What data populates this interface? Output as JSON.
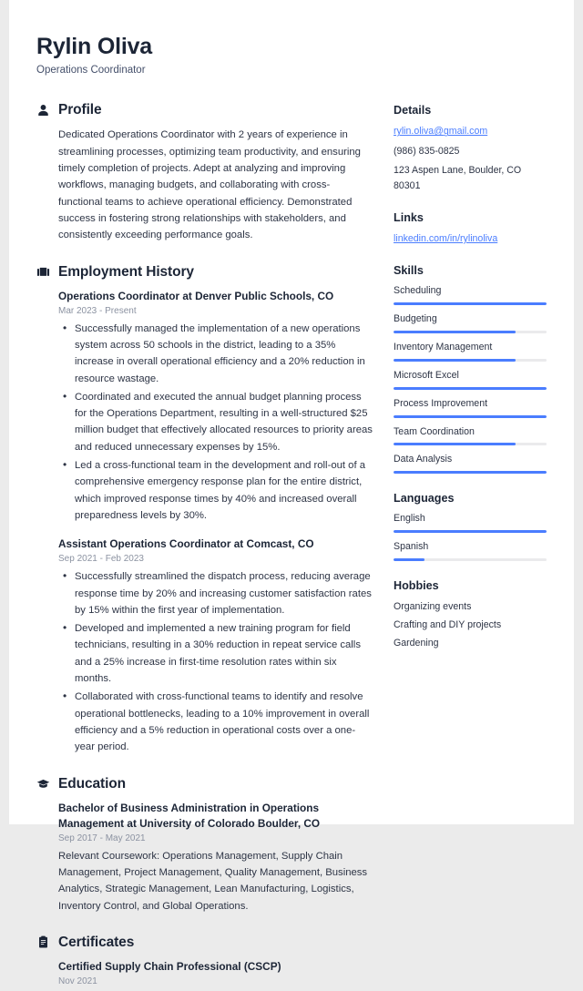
{
  "accent_color": "#4a7dff",
  "text_color": "#2d3445",
  "heading_color": "#1c2536",
  "header": {
    "name": "Rylin Oliva",
    "job_title": "Operations Coordinator"
  },
  "sections": {
    "profile": {
      "icon": "person-icon",
      "title": "Profile",
      "text": "Dedicated Operations Coordinator with 2 years of experience in streamlining processes, optimizing team productivity, and ensuring timely completion of projects. Adept at analyzing and improving workflows, managing budgets, and collaborating with cross-functional teams to achieve operational efficiency. Demonstrated success in fostering strong relationships with stakeholders, and consistently exceeding performance goals."
    },
    "employment": {
      "icon": "briefcase-icon",
      "title": "Employment History",
      "entries": [
        {
          "title": "Operations Coordinator at Denver Public Schools, CO",
          "date": "Mar 2023 - Present",
          "bullets": [
            "Successfully managed the implementation of a new operations system across 50 schools in the district, leading to a 35% increase in overall operational efficiency and a 20% reduction in resource wastage.",
            "Coordinated and executed the annual budget planning process for the Operations Department, resulting in a well-structured $25 million budget that effectively allocated resources to priority areas and reduced unnecessary expenses by 15%.",
            "Led a cross-functional team in the development and roll-out of a comprehensive emergency response plan for the entire district, which improved response times by 40% and increased overall preparedness levels by 30%."
          ]
        },
        {
          "title": "Assistant Operations Coordinator at Comcast, CO",
          "date": "Sep 2021 - Feb 2023",
          "bullets": [
            "Successfully streamlined the dispatch process, reducing average response time by 20% and increasing customer satisfaction rates by 15% within the first year of implementation.",
            "Developed and implemented a new training program for field technicians, resulting in a 30% reduction in repeat service calls and a 25% increase in first-time resolution rates within six months.",
            "Collaborated with cross-functional teams to identify and resolve operational bottlenecks, leading to a 10% improvement in overall efficiency and a 5% reduction in operational costs over a one-year period."
          ]
        }
      ]
    },
    "education": {
      "icon": "graduation-cap-icon",
      "title": "Education",
      "entries": [
        {
          "title": "Bachelor of Business Administration in Operations Management at University of Colorado Boulder, CO",
          "date": "Sep 2017 - May 2021",
          "description": "Relevant Coursework: Operations Management, Supply Chain Management, Project Management, Quality Management, Business Analytics, Strategic Management, Lean Manufacturing, Logistics, Inventory Control, and Global Operations."
        }
      ]
    },
    "certificates": {
      "icon": "clipboard-icon",
      "title": "Certificates",
      "entries": [
        {
          "title": "Certified Supply Chain Professional (CSCP)",
          "date": "Nov 2021"
        }
      ]
    }
  },
  "sidebar": {
    "details": {
      "title": "Details",
      "email": "rylin.oliva@gmail.com",
      "phone": "(986) 835-0825",
      "address": "123 Aspen Lane, Boulder, CO 80301"
    },
    "links": {
      "title": "Links",
      "items": [
        {
          "label": "linkedin.com/in/rylinoliva"
        }
      ]
    },
    "skills": {
      "title": "Skills",
      "items": [
        {
          "name": "Scheduling",
          "level": 100
        },
        {
          "name": "Budgeting",
          "level": 80
        },
        {
          "name": "Inventory Management",
          "level": 80
        },
        {
          "name": "Microsoft Excel",
          "level": 100
        },
        {
          "name": "Process Improvement",
          "level": 100
        },
        {
          "name": "Team Coordination",
          "level": 80
        },
        {
          "name": "Data Analysis",
          "level": 100
        }
      ]
    },
    "languages": {
      "title": "Languages",
      "items": [
        {
          "name": "English",
          "level": 100
        },
        {
          "name": "Spanish",
          "level": 20
        }
      ]
    },
    "hobbies": {
      "title": "Hobbies",
      "items": [
        {
          "label": "Organizing events"
        },
        {
          "label": "Crafting and DIY projects"
        },
        {
          "label": "Gardening"
        }
      ]
    }
  }
}
